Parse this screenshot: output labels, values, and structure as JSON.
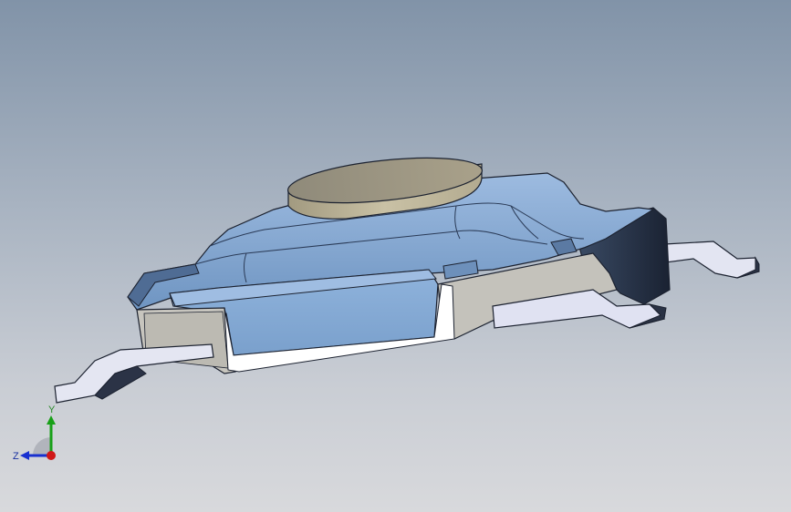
{
  "viewport": {
    "background_top": "#8193a8",
    "background_bottom": "#d8d9dc"
  },
  "model": {
    "body_color": "#7fa6d0",
    "body_shadow": "#5e7fa8",
    "housing_color": "#c8c6bf",
    "actuator_color": "#bdb59a",
    "lead_color": "#e2e4f0",
    "edge_color": "#1c2230"
  },
  "triad": {
    "x_label": "",
    "y_label": "Y",
    "z_label": "Z",
    "x_color": "#d01818",
    "y_color": "#18a018",
    "z_color": "#1830d0"
  }
}
